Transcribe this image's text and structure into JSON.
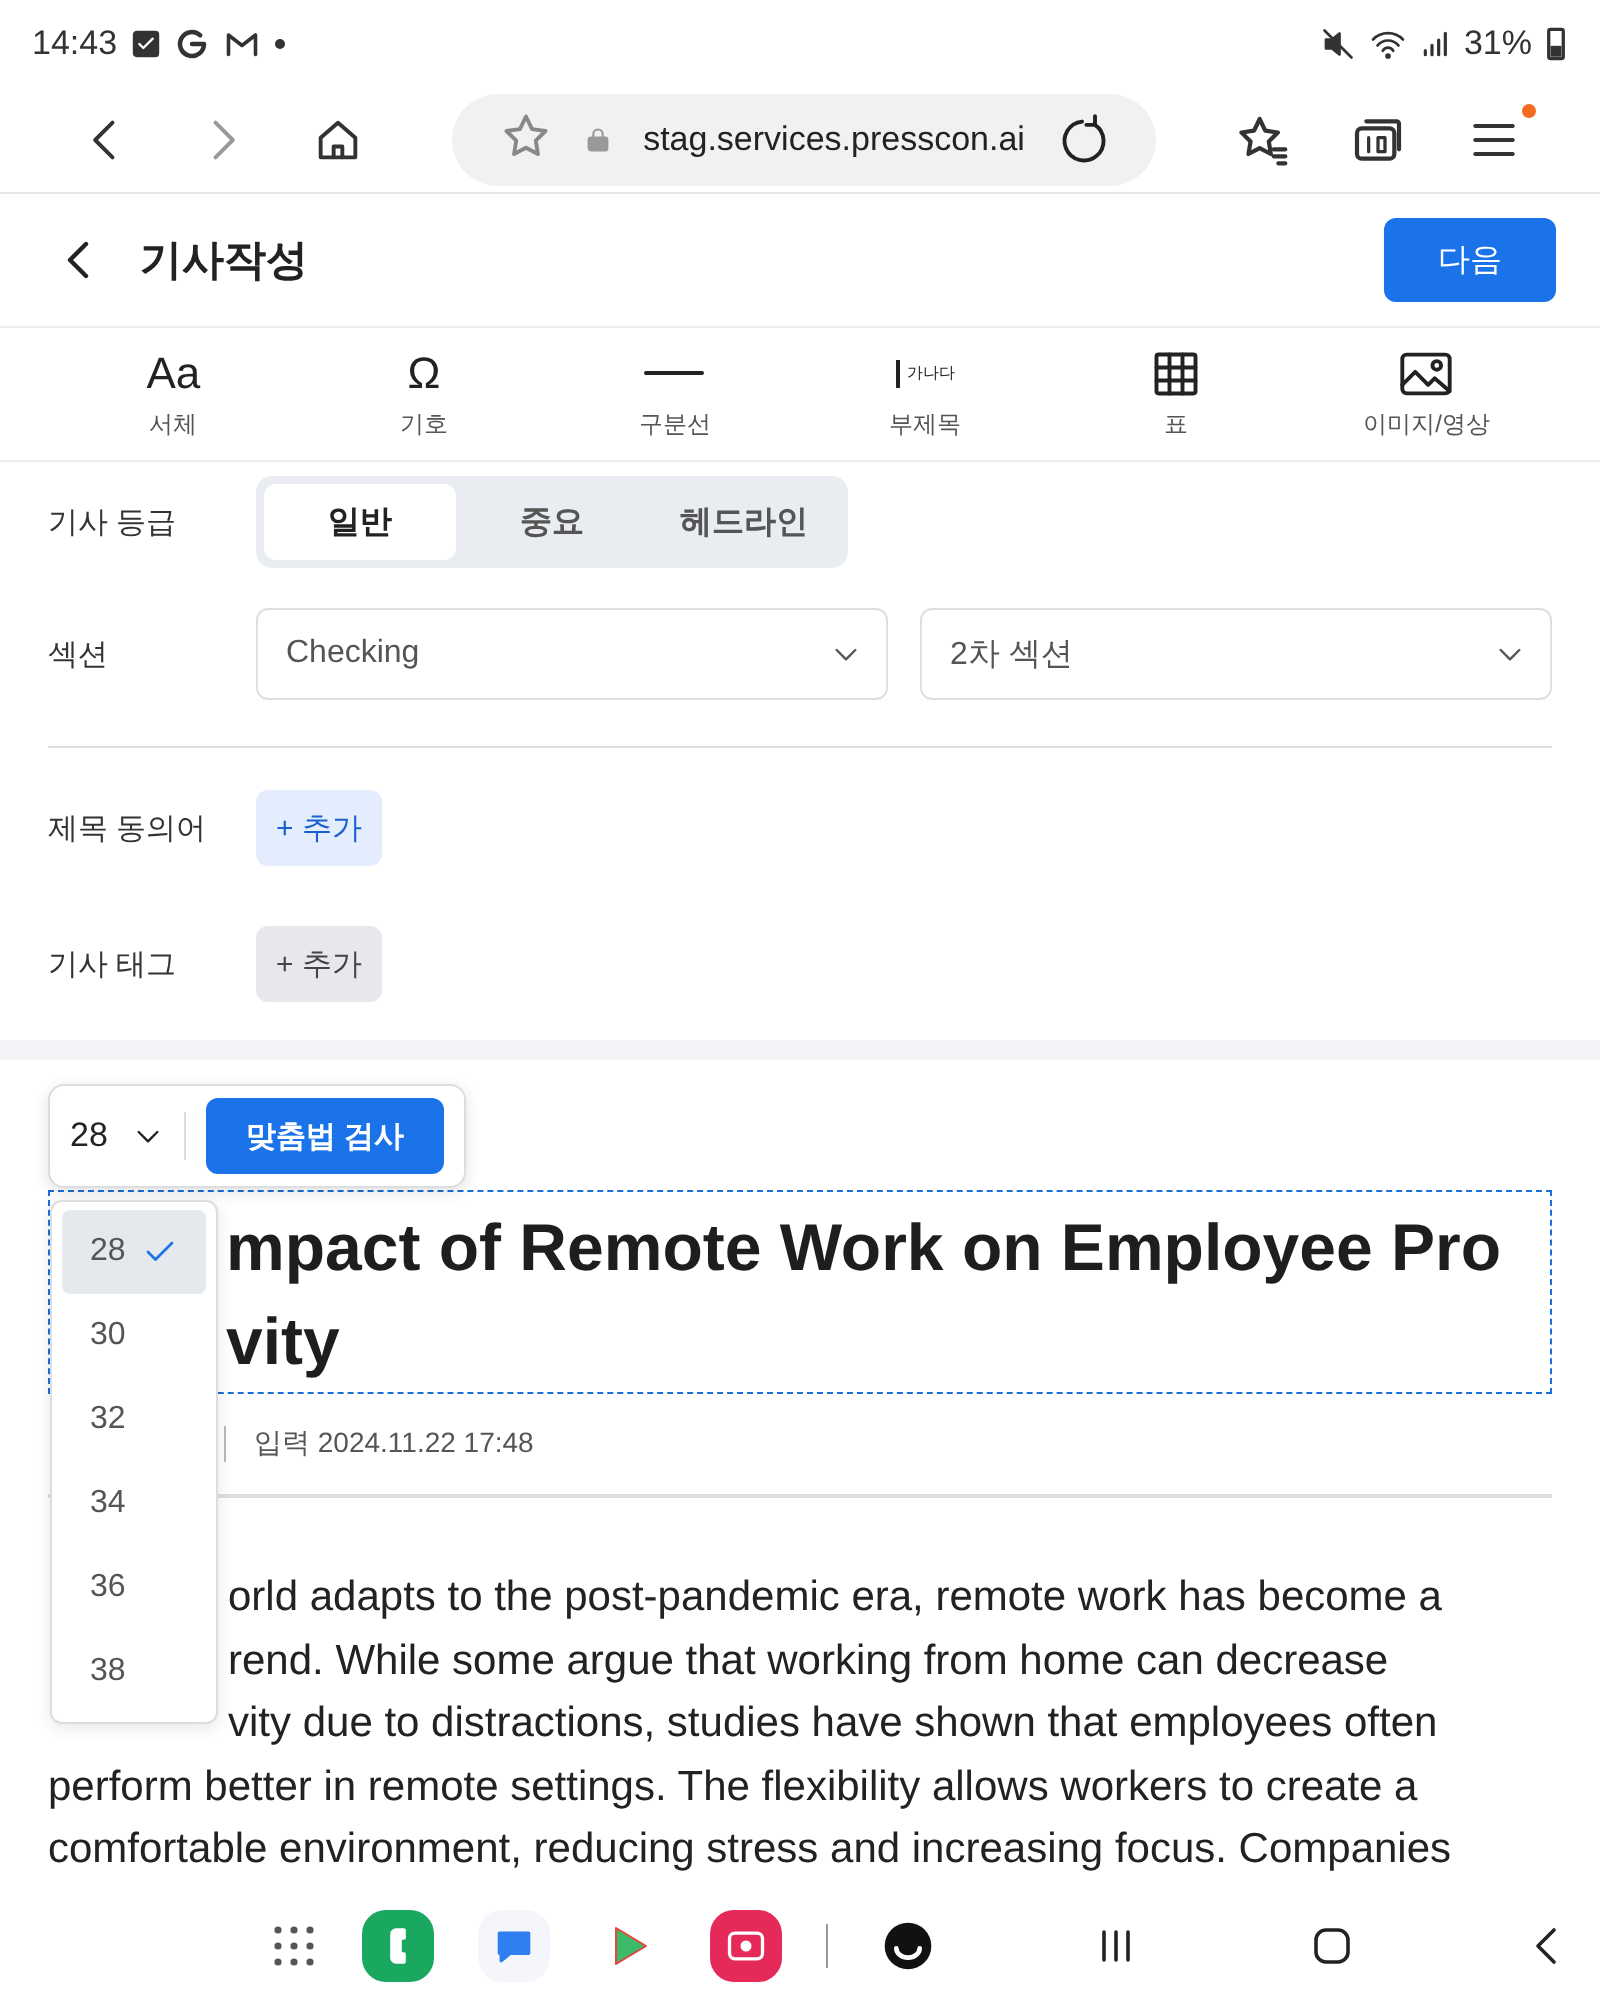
{
  "status_bar": {
    "time": "14:43",
    "battery": "31%"
  },
  "browser": {
    "url": "stag.services.presscon.ai"
  },
  "header": {
    "title": "기사작성",
    "next_button": "다음"
  },
  "toolbar": [
    {
      "kind": "font",
      "label": "서체",
      "glyph": "Aa"
    },
    {
      "kind": "symbol",
      "label": "기호",
      "glyph": "Ω"
    },
    {
      "kind": "divider",
      "label": "구분선"
    },
    {
      "kind": "subtitle",
      "label": "부제목",
      "sample": "가나다"
    },
    {
      "kind": "table",
      "label": "표"
    },
    {
      "kind": "image",
      "label": "이미지/영상"
    }
  ],
  "form": {
    "grade": {
      "label": "기사 등급",
      "options": [
        {
          "label": "일반",
          "selected": true
        },
        {
          "label": "중요",
          "selected": false
        },
        {
          "label": "헤드라인",
          "selected": false
        }
      ]
    },
    "section": {
      "label": "섹션",
      "primary": "Checking",
      "secondary_placeholder": "2차 섹션"
    },
    "synonyms": {
      "label": "제목 동의어",
      "add_button": {
        "label": "+ 추가",
        "kind": "primary"
      }
    },
    "tags": {
      "label": "기사 태그",
      "add_button": {
        "label": "+ 추가",
        "kind": "neutral"
      }
    }
  },
  "editor": {
    "font_size": "28",
    "spell_check": "맞춤법 검사",
    "size_options": [
      {
        "label": "28",
        "selected": true
      },
      {
        "label": "30",
        "selected": false
      },
      {
        "label": "32",
        "selected": false
      },
      {
        "label": "34",
        "selected": false
      },
      {
        "label": "36",
        "selected": false
      },
      {
        "label": "38",
        "selected": false
      }
    ],
    "title_lines": [
      "mpact of Remote Work on Employee Pro",
      "vity"
    ],
    "byline": "입력 2024.11.22 17:48",
    "body_lines": [
      {
        "text": "orld adapts to the post-pandemic era, remote work has become a",
        "covered": true
      },
      {
        "text": "rend. While some argue that working from home can decrease",
        "covered": true
      },
      {
        "text": "vity due to distractions, studies have shown that employees often",
        "covered": true
      },
      {
        "text": "perform better in remote settings. The flexibility allows workers to create a"
      },
      {
        "text": "comfortable environment, reducing stress and increasing focus. Companies"
      }
    ]
  }
}
